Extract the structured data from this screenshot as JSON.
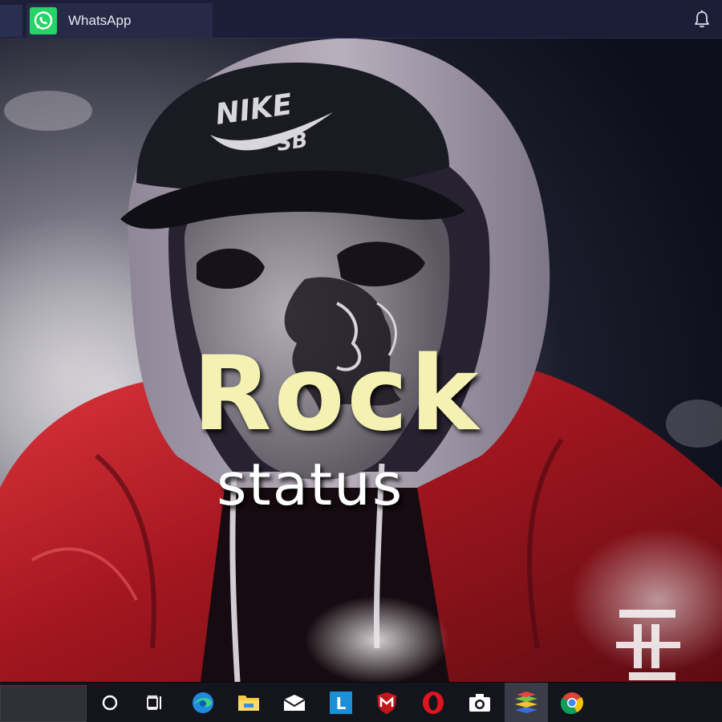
{
  "tab": {
    "title": "WhatsApp",
    "icon": "whatsapp-icon"
  },
  "header": {
    "icon": "bell-icon"
  },
  "overlay": {
    "title": "Rock",
    "subtitle": "status"
  },
  "taskbar": {
    "items": [
      {
        "icon": "cortana-circle-icon"
      },
      {
        "icon": "task-view-icon"
      },
      {
        "icon": "edge-browser-icon"
      },
      {
        "icon": "file-explorer-icon"
      },
      {
        "icon": "mail-icon"
      },
      {
        "icon": "l-app-icon"
      },
      {
        "icon": "mcafee-icon"
      },
      {
        "icon": "opera-icon"
      },
      {
        "icon": "camera-icon"
      },
      {
        "icon": "bluestacks-icon"
      },
      {
        "icon": "chrome-icon"
      }
    ]
  },
  "colors": {
    "whatsapp_green": "#25d366",
    "title_yellow": "#f4f1b2",
    "jacket_red": "#b01c24",
    "topbar_bg": "#1b1e36"
  }
}
